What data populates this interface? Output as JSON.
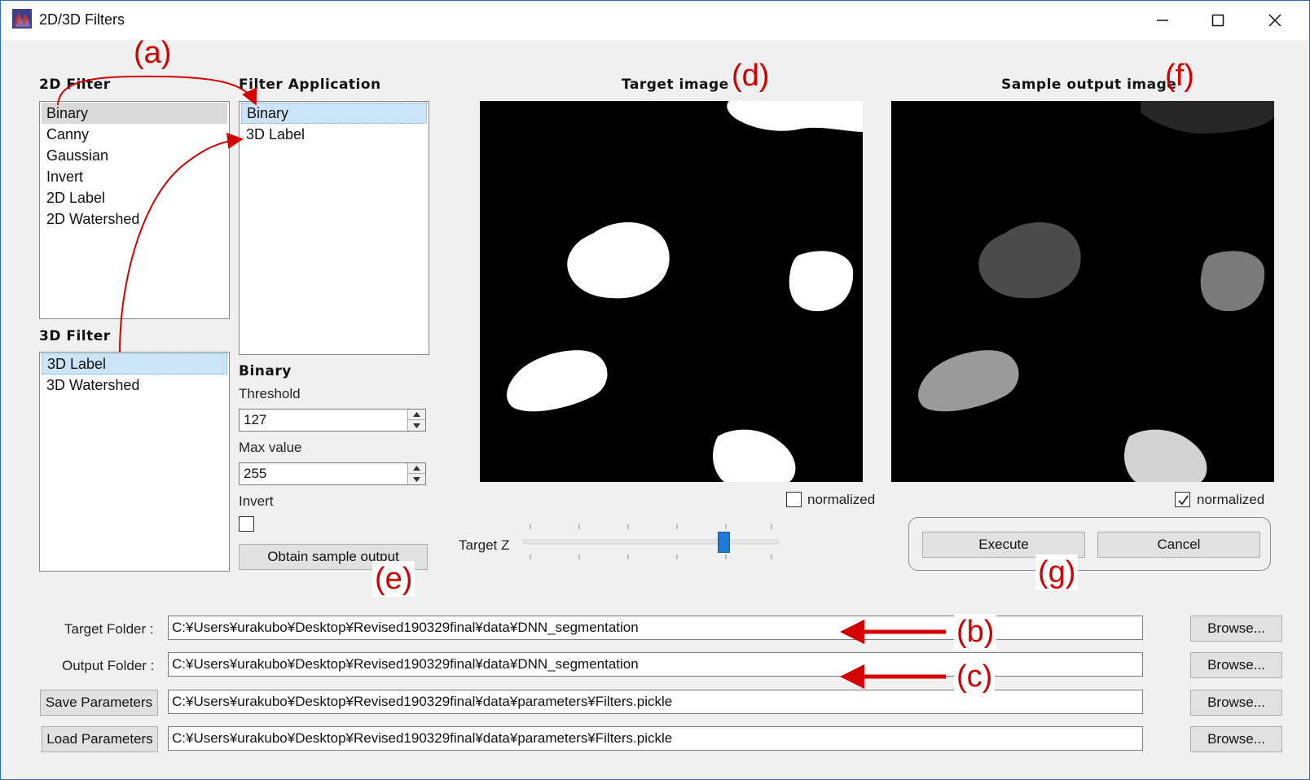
{
  "window": {
    "title": "2D/3D Filters"
  },
  "filter2d": {
    "label": "2D Filter",
    "items": [
      "Binary",
      "Canny",
      "Gaussian",
      "Invert",
      "2D Label",
      "2D Watershed"
    ],
    "selected": "Binary"
  },
  "filter3d": {
    "label": "3D Filter",
    "items": [
      "3D Label",
      "3D Watershed"
    ],
    "selected": "3D Label"
  },
  "application": {
    "label": "Filter Application",
    "items": [
      "Binary",
      "3D Label"
    ],
    "selected": "Binary"
  },
  "params": {
    "filter_name": "Binary",
    "threshold_label": "Threshold",
    "threshold_value": "127",
    "maxvalue_label": "Max value",
    "maxvalue_value": "255",
    "invert_label": "Invert",
    "invert_checked": false,
    "obtain_button": "Obtain sample output"
  },
  "target_image": {
    "title": "Target image",
    "normalized_label": "normalized",
    "normalized_checked": false
  },
  "sample_image": {
    "title": "Sample output image",
    "normalized_label": "normalized",
    "normalized_checked": true
  },
  "slider": {
    "label": "Target Z",
    "value_fraction": 0.8
  },
  "actions": {
    "execute": "Execute",
    "cancel": "Cancel"
  },
  "folders": {
    "target_label": "Target Folder :",
    "target_path": "C:¥Users¥urakubo¥Desktop¥Revised190329final¥data¥DNN_segmentation",
    "output_label": "Output Folder :",
    "output_path": "C:¥Users¥urakubo¥Desktop¥Revised190329final¥data¥DNN_segmentation",
    "save_button": "Save Parameters",
    "save_path": "C:¥Users¥urakubo¥Desktop¥Revised190329final¥data¥parameters¥Filters.pickle",
    "load_button": "Load Parameters",
    "load_path": "C:¥Users¥urakubo¥Desktop¥Revised190329final¥data¥parameters¥Filters.pickle",
    "browse": "Browse..."
  },
  "annotations": {
    "a": "(a)",
    "b": "(b)",
    "c": "(c)",
    "d": "(d)",
    "e": "(e)",
    "f": "(f)",
    "g": "(g)"
  },
  "colors": {
    "annotation": "#d40000",
    "selection_blue": "#cce4f7",
    "slider_thumb": "#1e78d7"
  },
  "icons": {
    "app": "app-icon",
    "minimize": "minimize-icon",
    "maximize": "maximize-icon",
    "close": "close-icon",
    "checkmark": "checkmark-icon",
    "spin_up": "spin-up-icon",
    "spin_down": "spin-down-icon"
  }
}
